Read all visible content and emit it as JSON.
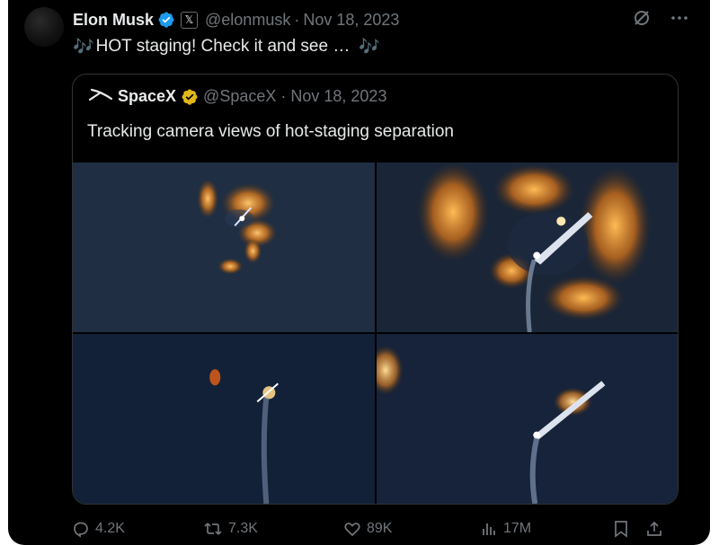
{
  "tweet": {
    "author_name": "Elon Musk",
    "x_badge": "𝕏",
    "handle": "@elonmusk",
    "separator": "·",
    "date": "Nov 18, 2023",
    "text": "HOT staging! Check it and see …",
    "note_emoji": "🎶"
  },
  "quote": {
    "author_name": "SpaceX",
    "handle": "@SpaceX",
    "separator": "·",
    "date": "Nov 18, 2023",
    "text": "Tracking camera views of hot-staging separation"
  },
  "actions": {
    "replies": "4.2K",
    "reposts": "7.3K",
    "likes": "89K",
    "views": "17M"
  },
  "icons": [
    "grok-icon",
    "more-icon",
    "verified-blue-icon",
    "verified-gold-icon",
    "spacex-logo-icon",
    "reply-icon",
    "repost-icon",
    "like-icon",
    "views-icon",
    "bookmark-icon",
    "share-icon"
  ],
  "colors": {
    "background": "#000000",
    "text": "#e7e9ea",
    "muted": "#71767b",
    "verified_blue": "#1d9bf0",
    "verified_gold": "#e2b719",
    "border": "#2f3336"
  }
}
